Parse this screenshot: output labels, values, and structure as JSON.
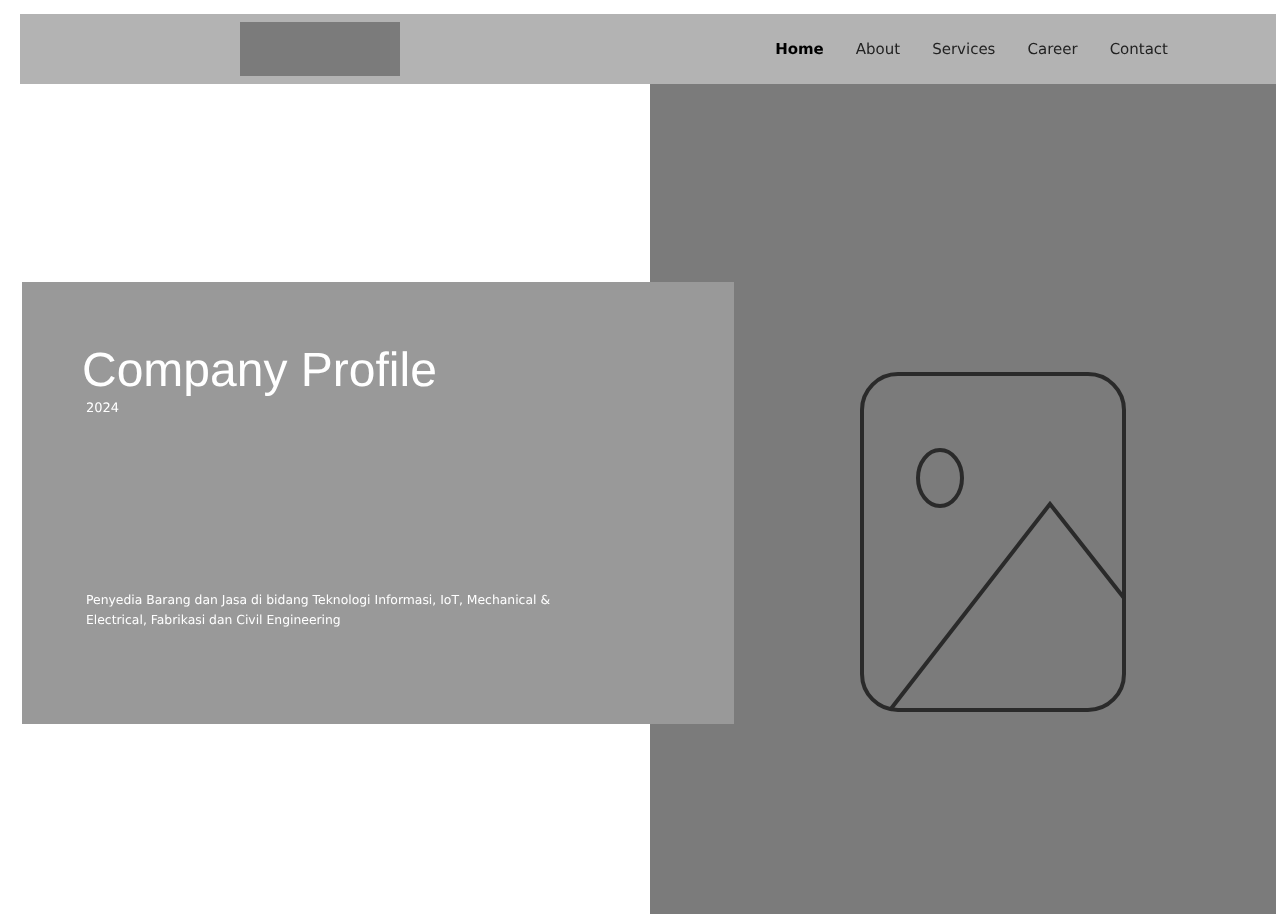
{
  "nav": {
    "items": [
      {
        "label": "Home",
        "selected": true
      },
      {
        "label": "About",
        "selected": false
      },
      {
        "label": "Services",
        "selected": false
      },
      {
        "label": "Career",
        "selected": false
      },
      {
        "label": "Contact",
        "selected": false
      }
    ]
  },
  "hero": {
    "title": "Company Profile",
    "year": "2024",
    "description": "Penyedia Barang dan Jasa di bidang Teknologi Informasi, IoT, Mechanical & Electrical, Fabrikasi dan Civil Engineering"
  }
}
